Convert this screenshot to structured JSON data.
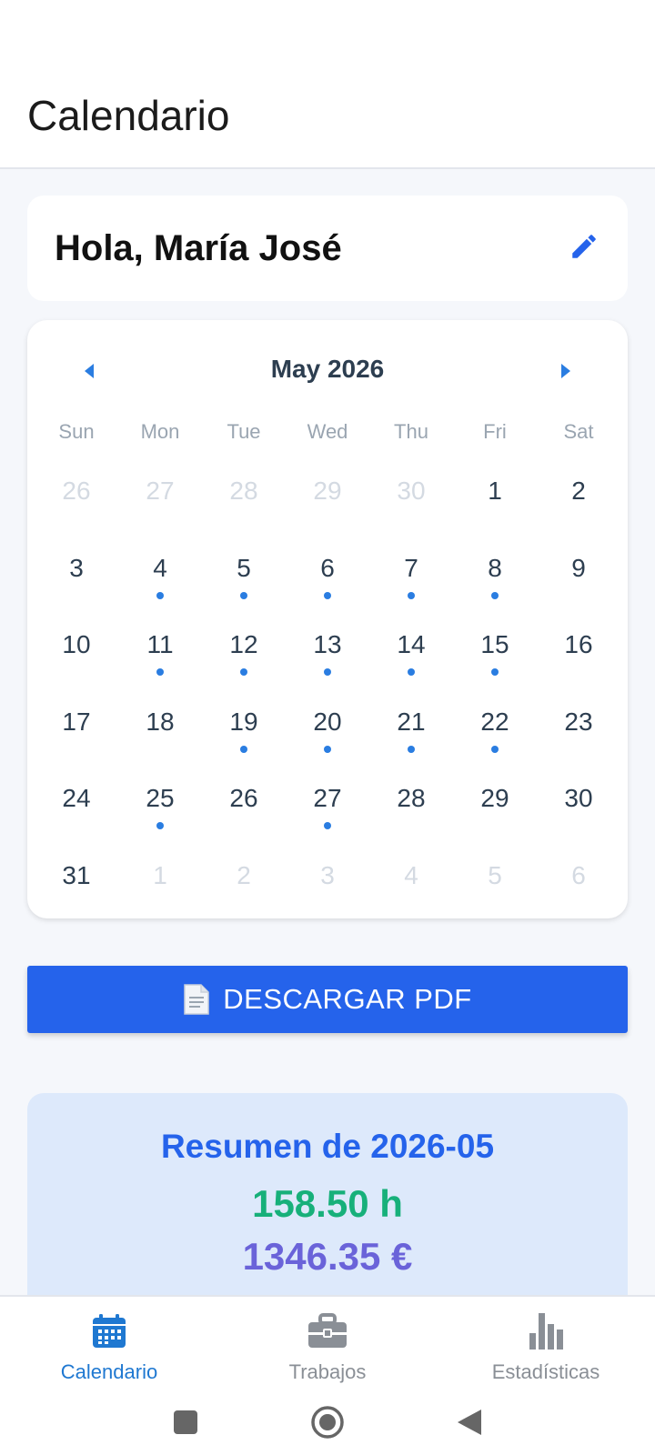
{
  "header": {
    "title": "Calendario"
  },
  "greeting": {
    "text": "Hola, María José"
  },
  "calendar": {
    "month_label": "May 2026",
    "weekdays": [
      "Sun",
      "Mon",
      "Tue",
      "Wed",
      "Thu",
      "Fri",
      "Sat"
    ],
    "days": [
      {
        "label": "26",
        "current": false,
        "dot": false
      },
      {
        "label": "27",
        "current": false,
        "dot": false
      },
      {
        "label": "28",
        "current": false,
        "dot": false
      },
      {
        "label": "29",
        "current": false,
        "dot": false
      },
      {
        "label": "30",
        "current": false,
        "dot": false
      },
      {
        "label": "1",
        "current": true,
        "dot": false
      },
      {
        "label": "2",
        "current": true,
        "dot": false
      },
      {
        "label": "3",
        "current": true,
        "dot": false
      },
      {
        "label": "4",
        "current": true,
        "dot": true
      },
      {
        "label": "5",
        "current": true,
        "dot": true
      },
      {
        "label": "6",
        "current": true,
        "dot": true
      },
      {
        "label": "7",
        "current": true,
        "dot": true
      },
      {
        "label": "8",
        "current": true,
        "dot": true
      },
      {
        "label": "9",
        "current": true,
        "dot": false
      },
      {
        "label": "10",
        "current": true,
        "dot": false
      },
      {
        "label": "11",
        "current": true,
        "dot": true
      },
      {
        "label": "12",
        "current": true,
        "dot": true
      },
      {
        "label": "13",
        "current": true,
        "dot": true
      },
      {
        "label": "14",
        "current": true,
        "dot": true
      },
      {
        "label": "15",
        "current": true,
        "dot": true
      },
      {
        "label": "16",
        "current": true,
        "dot": false
      },
      {
        "label": "17",
        "current": true,
        "dot": false
      },
      {
        "label": "18",
        "current": true,
        "dot": false
      },
      {
        "label": "19",
        "current": true,
        "dot": true
      },
      {
        "label": "20",
        "current": true,
        "dot": true
      },
      {
        "label": "21",
        "current": true,
        "dot": true
      },
      {
        "label": "22",
        "current": true,
        "dot": true
      },
      {
        "label": "23",
        "current": true,
        "dot": false
      },
      {
        "label": "24",
        "current": true,
        "dot": false
      },
      {
        "label": "25",
        "current": true,
        "dot": true
      },
      {
        "label": "26",
        "current": true,
        "dot": false
      },
      {
        "label": "27",
        "current": true,
        "dot": true
      },
      {
        "label": "28",
        "current": true,
        "dot": false
      },
      {
        "label": "29",
        "current": true,
        "dot": false
      },
      {
        "label": "30",
        "current": true,
        "dot": false
      },
      {
        "label": "31",
        "current": true,
        "dot": false
      },
      {
        "label": "1",
        "current": false,
        "dot": false
      },
      {
        "label": "2",
        "current": false,
        "dot": false
      },
      {
        "label": "3",
        "current": false,
        "dot": false
      },
      {
        "label": "4",
        "current": false,
        "dot": false
      },
      {
        "label": "5",
        "current": false,
        "dot": false
      },
      {
        "label": "6",
        "current": false,
        "dot": false
      }
    ]
  },
  "actions": {
    "download_pdf_label": "DESCARGAR PDF"
  },
  "summary": {
    "title": "Resumen de 2026-05",
    "hours": "158.50 h",
    "money": "1346.35 €"
  },
  "bottom_nav": {
    "tabs": [
      {
        "label": "Calendario",
        "icon": "calendar-icon",
        "active": true
      },
      {
        "label": "Trabajos",
        "icon": "briefcase-icon",
        "active": false
      },
      {
        "label": "Estadísticas",
        "icon": "bar-chart-icon",
        "active": false
      }
    ]
  },
  "colors": {
    "primary": "#2563eb",
    "accent_dot": "#2a7de1",
    "hours_green": "#17b07a",
    "money_purple": "#6a63d9",
    "summary_bg": "#dde9fb"
  }
}
